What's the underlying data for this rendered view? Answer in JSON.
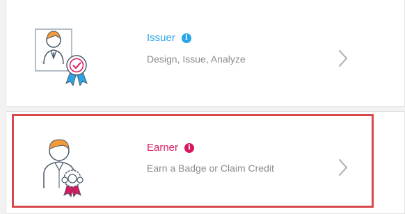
{
  "cards": [
    {
      "id": "issuer",
      "title": "Issuer",
      "subtitle": "Design, Issue, Analyze",
      "info_icon": "i",
      "accent": "#2aa6e8",
      "illustration": "issuer-with-certificate-and-badge",
      "chevron_icon": "chevron-right-icon"
    },
    {
      "id": "earner",
      "title": "Earner",
      "subtitle": "Earn a Badge or Claim Credit",
      "info_icon": "i",
      "accent": "#d9175f",
      "illustration": "earner-holding-badge",
      "chevron_icon": "chevron-right-icon",
      "selected": true
    }
  ],
  "colors": {
    "selection_border": "#d9484a",
    "subtitle": "#8b8b8b",
    "chevron": "#b5b5b5"
  }
}
